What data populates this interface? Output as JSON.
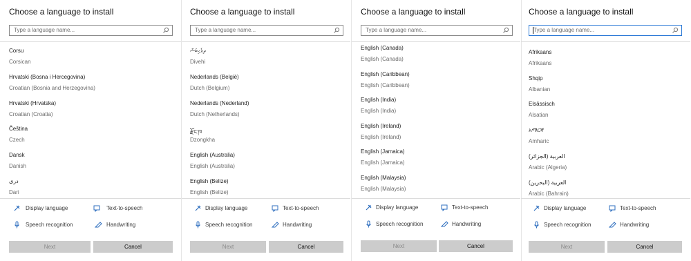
{
  "panels": [
    {
      "title": "Choose a language to install",
      "search": {
        "placeholder": "Type a language name...",
        "focused": false
      },
      "languages": [
        {
          "native": "Corsu",
          "english": "Corsican"
        },
        {
          "native": "Hrvatski (Bosna i Hercegovina)",
          "english": "Croatian (Bosnia and Herzegovina)"
        },
        {
          "native": "Hrvatski (Hrvatska)",
          "english": "Croatian (Croatia)"
        },
        {
          "native": "Čeština",
          "english": "Czech"
        },
        {
          "native": "Dansk",
          "english": "Danish"
        },
        {
          "native": "دری",
          "english": "Dari"
        }
      ],
      "features": {
        "display": "Display language",
        "tts": "Text-to-speech",
        "speech": "Speech recognition",
        "handwriting": "Handwriting"
      },
      "buttons": {
        "next": "Next",
        "cancel": "Cancel"
      }
    },
    {
      "title": "Choose a language to install",
      "search": {
        "placeholder": "Type a language name...",
        "focused": false
      },
      "languages": [
        {
          "native": "ދިވެހިބަސް",
          "english": "Divehi"
        },
        {
          "native": "Nederlands (België)",
          "english": "Dutch (Belgium)"
        },
        {
          "native": "Nederlands (Nederland)",
          "english": "Dutch (Netherlands)"
        },
        {
          "native": "རྫོང་ཁ",
          "english": "Dzongkha"
        },
        {
          "native": "English (Australia)",
          "english": "English (Australia)"
        },
        {
          "native": "English (Belize)",
          "english": "English (Belize)"
        }
      ],
      "features": {
        "display": "Display language",
        "tts": "Text-to-speech",
        "speech": "Speech recognition",
        "handwriting": "Handwriting"
      },
      "buttons": {
        "next": "Next",
        "cancel": "Cancel"
      }
    },
    {
      "title": "Choose a language to install",
      "search": {
        "placeholder": "Type a language name...",
        "focused": false
      },
      "languages": [
        {
          "native": "English (Canada)",
          "english": "English (Canada)"
        },
        {
          "native": "English (Caribbean)",
          "english": "English (Caribbean)"
        },
        {
          "native": "English (India)",
          "english": "English (India)"
        },
        {
          "native": "English (Ireland)",
          "english": "English (Ireland)"
        },
        {
          "native": "English (Jamaica)",
          "english": "English (Jamaica)"
        },
        {
          "native": "English (Malaysia)",
          "english": "English (Malaysia)"
        }
      ],
      "features": {
        "display": "Display language",
        "tts": "Text-to-speech",
        "speech": "Speech recognition",
        "handwriting": "Handwriting"
      },
      "buttons": {
        "next": "Next",
        "cancel": "Cancel"
      }
    },
    {
      "title": "Choose a language to install",
      "search": {
        "placeholder": "Type a language name...",
        "focused": true
      },
      "languages": [
        {
          "native": "Afrikaans",
          "english": "Afrikaans"
        },
        {
          "native": "Shqip",
          "english": "Albanian"
        },
        {
          "native": "Elsässisch",
          "english": "Alsatian"
        },
        {
          "native": "አማርኛ",
          "english": "Amharic"
        },
        {
          "native": "العربية (الجزائر)",
          "english": "Arabic (Algeria)"
        },
        {
          "native": "العربية (البحرين)",
          "english": "Arabic (Bahrain)"
        }
      ],
      "features": {
        "display": "Display language",
        "tts": "Text-to-speech",
        "speech": "Speech recognition",
        "handwriting": "Handwriting"
      },
      "buttons": {
        "next": "Next",
        "cancel": "Cancel"
      }
    }
  ],
  "colors": {
    "accent": "#2b79d6",
    "icon": "#2f6fbf",
    "button_bg": "#cccccc"
  },
  "icons": {
    "search": "magnifier-icon",
    "display": "display-language-icon",
    "tts": "text-to-speech-icon",
    "speech": "microphone-icon",
    "handwriting": "pen-icon"
  }
}
